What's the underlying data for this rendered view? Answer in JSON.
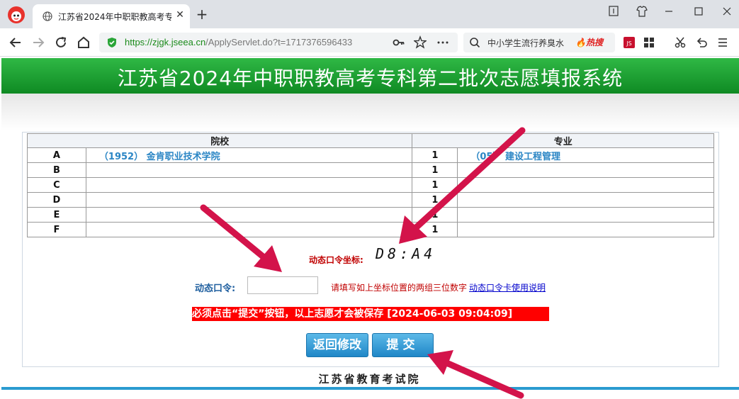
{
  "browser": {
    "tab_title": "江苏省2024年中职职教高考专",
    "url_host": "https://zjgk.jseea.cn",
    "url_rest": "/ApplyServlet.do?t=1717376596433",
    "search_text": "中小学生流行养臭水",
    "search_hot": "🔥热搜",
    "tab_close": "✕",
    "new_tab": "+"
  },
  "page": {
    "banner_title": "江苏省2024年中职职教高考专科第二批次志愿填报系统",
    "table": {
      "headers": [
        "院校",
        "专业"
      ],
      "rows": [
        {
          "letter": "A",
          "school": "（1952）  金肯职业技术学院",
          "order": "1",
          "major": "（05）  建设工程管理"
        },
        {
          "letter": "B",
          "school": "",
          "order": "1",
          "major": ""
        },
        {
          "letter": "C",
          "school": "",
          "order": "1",
          "major": ""
        },
        {
          "letter": "D",
          "school": "",
          "order": "1",
          "major": ""
        },
        {
          "letter": "E",
          "school": "",
          "order": "1",
          "major": ""
        },
        {
          "letter": "F",
          "school": "",
          "order": "1",
          "major": ""
        }
      ]
    },
    "coord_label": "动态口令坐标:",
    "coord_value": "D8:A4",
    "password_label": "动态口令:",
    "password_value": "",
    "password_hint": "请填写如上坐标位置的两组三位数字",
    "password_help_link": "动态口令卡使用说明",
    "notice": "必须点击“提交”按钮，以上志愿才会被保存 [2024-06-03 09:04:09]",
    "back_button": "返回修改",
    "submit_button": "提交",
    "footer": "江苏省教育考试院"
  },
  "colors": {
    "banner": "#1a9d30",
    "link_blue": "#2b86c5",
    "alert_red": "#ff0000",
    "annotation_arrow": "#d3134a"
  }
}
